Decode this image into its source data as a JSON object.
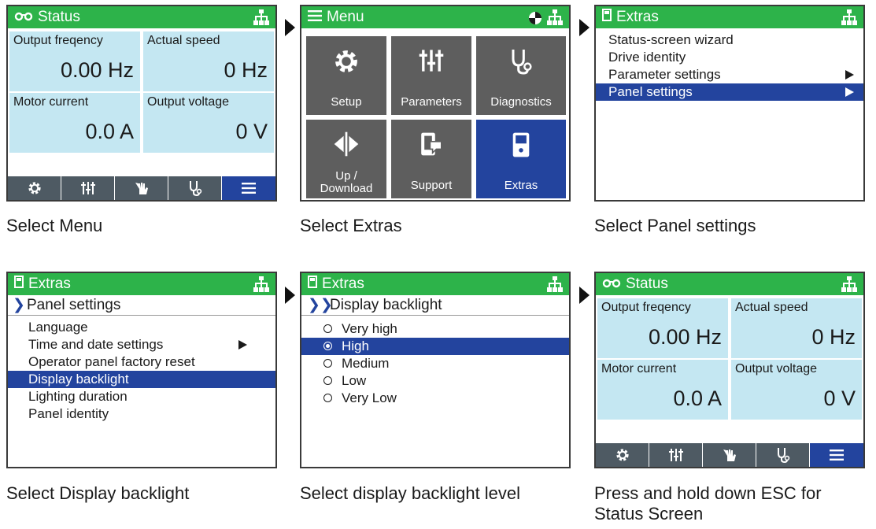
{
  "colors": {
    "header_green": "#2db34a",
    "tile_grey": "#5e5e5e",
    "selection_blue": "#23449e",
    "cell_blue": "#c4e7f2",
    "softkey_grey": "#4e5a63"
  },
  "status_screen": {
    "title": "Status",
    "cells": [
      {
        "label": "Output freqency",
        "value": "0.00 Hz"
      },
      {
        "label": "Actual speed",
        "value": "0 Hz"
      },
      {
        "label": "Motor current",
        "value": "0.0 A"
      },
      {
        "label": "Output voltage",
        "value": "0 V"
      }
    ],
    "softkeys": [
      "gear-icon",
      "sliders-icon",
      "hand-icon",
      "stethoscope-icon",
      "menu-icon"
    ],
    "active_softkey": "menu-icon"
  },
  "menu_screen": {
    "title": "Menu",
    "tiles": [
      {
        "label": "Setup",
        "icon": "gear-icon"
      },
      {
        "label": "Parameters",
        "icon": "sliders-icon"
      },
      {
        "label": "Diagnostics",
        "icon": "stethoscope-icon"
      },
      {
        "label": "Up /\nDownload",
        "icon": "transfer-icon"
      },
      {
        "label": "Support",
        "icon": "support-icon"
      },
      {
        "label": "Extras",
        "icon": "panel-icon"
      }
    ],
    "selected_tile": "Extras"
  },
  "extras_screen": {
    "title": "Extras",
    "items": [
      "Status-screen wizard",
      "Drive identity",
      "Parameter settings",
      "Panel settings"
    ],
    "selected": "Panel settings"
  },
  "panel_settings_screen": {
    "title": "Extras",
    "breadcrumb": "Panel settings",
    "items": [
      "Language",
      "Time and date settings",
      "Operator panel factory reset",
      "Display backlight",
      "Lighting duration",
      "Panel identity"
    ],
    "selected": "Display backlight"
  },
  "backlight_screen": {
    "title": "Extras",
    "breadcrumb": "Display backlight",
    "options": [
      "Very high",
      "High",
      "Medium",
      "Low",
      "Very Low"
    ],
    "selected": "High"
  },
  "captions": {
    "c1": "Select Menu",
    "c2": "Select Extras",
    "c3": "Select Panel settings",
    "c4": "Select Display backlight",
    "c5": "Select display backlight level",
    "c6a": "Press and hold down ESC for",
    "c6b": "Status Screen"
  }
}
